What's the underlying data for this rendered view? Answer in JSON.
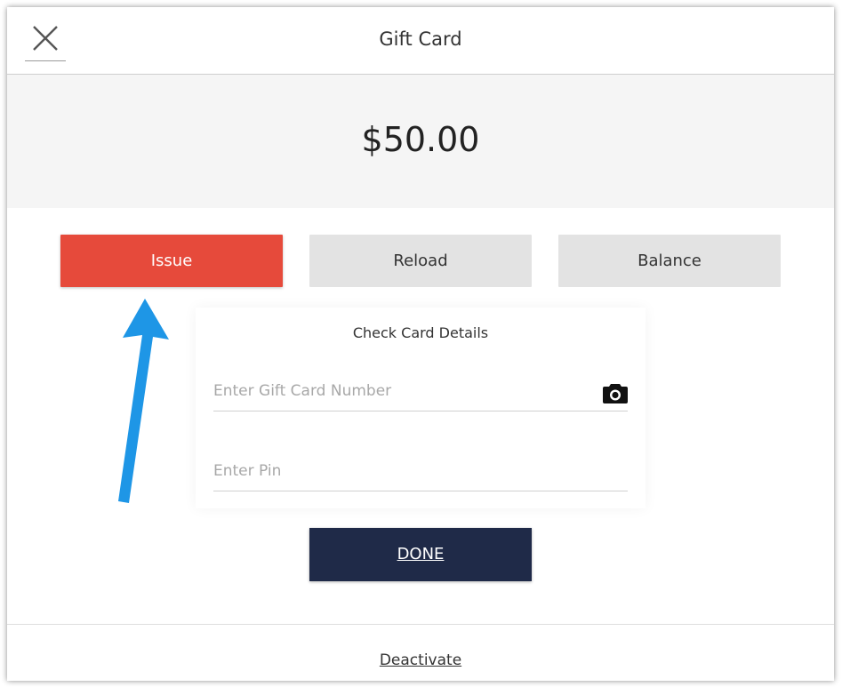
{
  "header": {
    "title": "Gift Card"
  },
  "amount": "$50.00",
  "mode_tabs": [
    {
      "label": "Issue",
      "active": true
    },
    {
      "label": "Reload",
      "active": false
    },
    {
      "label": "Balance",
      "active": false
    }
  ],
  "card_details": {
    "title": "Check Card Details",
    "card_number": {
      "value": "",
      "placeholder": "Enter Gift Card Number"
    },
    "pin": {
      "value": "",
      "placeholder": "Enter Pin"
    }
  },
  "done_label": "DONE",
  "footer": {
    "deactivate_label": "Deactivate"
  },
  "icons": {
    "close": "close-icon",
    "camera": "camera-icon",
    "annotation_arrow": "arrow-up-icon"
  },
  "colors": {
    "active_tab": "#e64a3b",
    "inactive_tab": "#e3e3e3",
    "done_button": "#1f2a48",
    "amount_band": "#f5f5f5",
    "annotation_arrow": "#1e96e6"
  }
}
